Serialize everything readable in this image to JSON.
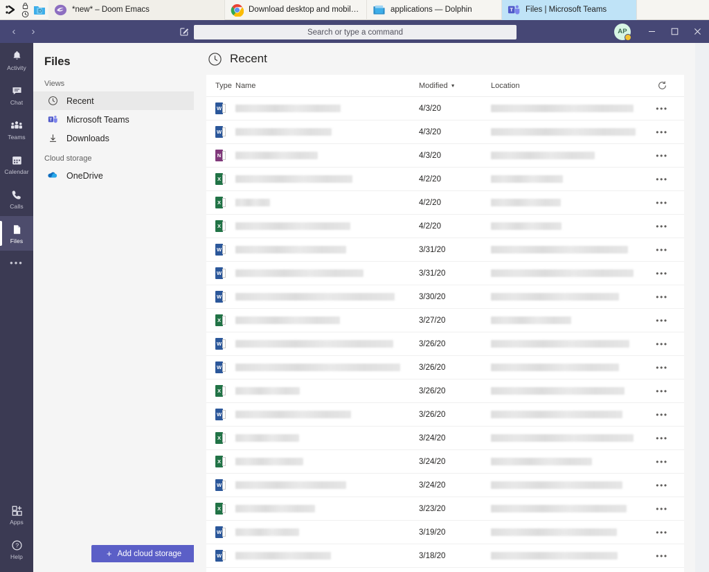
{
  "taskbar": {
    "tasks": [
      {
        "label": "*new* – Doom Emacs",
        "icon": "emacs-icon",
        "state": "shade",
        "width_class": "wide"
      },
      {
        "label": "Download desktop and mobile app...",
        "icon": "chrome-icon",
        "state": "normal",
        "width_class": "w2"
      },
      {
        "label": "applications — Dolphin",
        "icon": "dolphin-folder-icon",
        "state": "normal",
        "width_class": "w3"
      },
      {
        "label": "Files | Microsoft Teams",
        "icon": "teams-icon",
        "state": "active",
        "width_class": "w4"
      }
    ],
    "system_icons": [
      "kicker-icon",
      "lock-icon",
      "clock-icon",
      "file-manager-icon"
    ]
  },
  "titlebar": {
    "back_arrow": "‹",
    "forward_arrow": "›",
    "compose_icon": "compose-icon",
    "avatar_initials": "AP",
    "presence": "away",
    "presence_color": "#f2c230",
    "minimize_label": "Minimize",
    "maximize_label": "Maximize",
    "close_label": "Close"
  },
  "search": {
    "placeholder": "Search or type a command",
    "value": ""
  },
  "rail": {
    "items": [
      {
        "label": "Activity",
        "icon": "bell-icon",
        "selected": false
      },
      {
        "label": "Chat",
        "icon": "chat-icon",
        "selected": false
      },
      {
        "label": "Teams",
        "icon": "teams-people-icon",
        "selected": false
      },
      {
        "label": "Calendar",
        "icon": "calendar-icon",
        "selected": false
      },
      {
        "label": "Calls",
        "icon": "phone-icon",
        "selected": false
      },
      {
        "label": "Files",
        "icon": "file-icon",
        "selected": true
      }
    ],
    "more_label": "•••",
    "bottom_items": [
      {
        "label": "Apps",
        "icon": "apps-grid-icon"
      },
      {
        "label": "Help",
        "icon": "help-question-icon"
      }
    ]
  },
  "sidebar": {
    "title": "Files",
    "sections": [
      {
        "heading": "Views",
        "items": [
          {
            "label": "Recent",
            "icon": "clock-icon",
            "active": true
          },
          {
            "label": "Microsoft Teams",
            "icon": "teams-icon",
            "active": false
          },
          {
            "label": "Downloads",
            "icon": "download-arrow-icon",
            "active": false
          }
        ]
      },
      {
        "heading": "Cloud storage",
        "items": [
          {
            "label": "OneDrive",
            "icon": "onedrive-cloud-icon",
            "active": false
          }
        ]
      }
    ],
    "add_cloud_storage_label": "Add cloud storage",
    "add_cloud_storage_icon": "plus-icon"
  },
  "main": {
    "page_title": "Recent",
    "page_title_icon": "clock-icon",
    "refresh_icon": "refresh-icon",
    "columns": {
      "type": "Type",
      "name": "Name",
      "modified": "Modified",
      "modified_sorted": true,
      "sort_caret": "▼",
      "location": "Location"
    },
    "row_action_icon": "more-options-icon",
    "row_action_label": "•••",
    "files": [
      {
        "type": "word",
        "name_redacted": true,
        "name_width": 152,
        "modified": "4/3/20",
        "location_redacted": true,
        "location_width": 206
      },
      {
        "type": "word",
        "name_redacted": true,
        "name_width": 139,
        "modified": "4/3/20",
        "location_redacted": true,
        "location_width": 209
      },
      {
        "type": "onenote",
        "name_redacted": true,
        "name_width": 119,
        "modified": "4/3/20",
        "location_redacted": true,
        "location_width": 150
      },
      {
        "type": "excel",
        "name_redacted": true,
        "name_width": 169,
        "modified": "4/2/20",
        "location_redacted": true,
        "location_width": 104
      },
      {
        "type": "excel",
        "name_redacted": true,
        "name_width": 50,
        "modified": "4/2/20",
        "location_redacted": true,
        "location_width": 101
      },
      {
        "type": "excel",
        "name_redacted": true,
        "name_width": 166,
        "modified": "4/2/20",
        "location_redacted": true,
        "location_width": 102
      },
      {
        "type": "word",
        "name_redacted": true,
        "name_width": 160,
        "modified": "3/31/20",
        "location_redacted": true,
        "location_width": 198
      },
      {
        "type": "word",
        "name_redacted": true,
        "name_width": 185,
        "modified": "3/31/20",
        "location_redacted": true,
        "location_width": 206
      },
      {
        "type": "word",
        "name_redacted": true,
        "name_width": 230,
        "modified": "3/30/20",
        "location_redacted": true,
        "location_width": 185
      },
      {
        "type": "excel",
        "name_redacted": true,
        "name_width": 151,
        "modified": "3/27/20",
        "location_redacted": true,
        "location_width": 116
      },
      {
        "type": "word",
        "name_redacted": true,
        "name_width": 228,
        "modified": "3/26/20",
        "location_redacted": true,
        "location_width": 200
      },
      {
        "type": "word",
        "name_redacted": true,
        "name_width": 238,
        "modified": "3/26/20",
        "location_redacted": true,
        "location_width": 185
      },
      {
        "type": "excel",
        "name_redacted": true,
        "name_width": 93,
        "modified": "3/26/20",
        "location_redacted": true,
        "location_width": 193
      },
      {
        "type": "word",
        "name_redacted": true,
        "name_width": 167,
        "modified": "3/26/20",
        "location_redacted": true,
        "location_width": 190
      },
      {
        "type": "excel",
        "name_redacted": true,
        "name_width": 92,
        "modified": "3/24/20",
        "location_redacted": true,
        "location_width": 206
      },
      {
        "type": "excel",
        "name_redacted": true,
        "name_width": 98,
        "modified": "3/24/20",
        "location_redacted": true,
        "location_width": 146
      },
      {
        "type": "word",
        "name_redacted": true,
        "name_width": 160,
        "modified": "3/24/20",
        "location_redacted": true,
        "location_width": 190
      },
      {
        "type": "excel",
        "name_redacted": true,
        "name_width": 115,
        "modified": "3/23/20",
        "location_redacted": true,
        "location_width": 196
      },
      {
        "type": "word",
        "name_redacted": true,
        "name_width": 92,
        "modified": "3/19/20",
        "location_redacted": true,
        "location_width": 182
      },
      {
        "type": "word",
        "name_redacted": true,
        "name_width": 138,
        "modified": "3/18/20",
        "location_redacted": true,
        "location_width": 183
      }
    ]
  },
  "colors": {
    "teams_purple": "#464775",
    "rail_dark": "#3b3a53",
    "accent_button": "#5b5fc7",
    "word_blue": "#2b579a",
    "excel_green": "#217346",
    "onenote_purple": "#80397b",
    "taskbar_active": "#bfe3f7"
  }
}
